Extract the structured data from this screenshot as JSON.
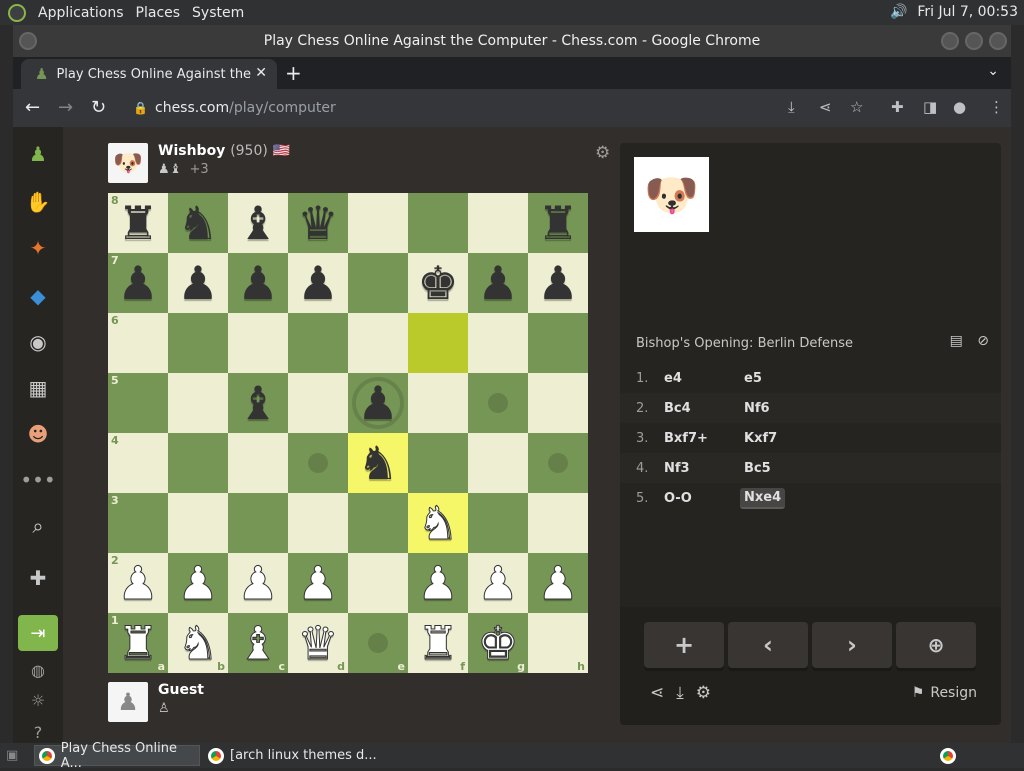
{
  "os": {
    "menu": [
      "Applications",
      "Places",
      "System"
    ],
    "clock": "Fri Jul  7, 00:53"
  },
  "window": {
    "title": "Play Chess Online Against the Computer - Chess.com - Google Chrome"
  },
  "browser": {
    "tab_title": "Play Chess Online Against the",
    "url_host": "chess.com",
    "url_path": "/play/computer"
  },
  "top_player": {
    "name": "Wishboy",
    "rating": "(950)",
    "flag": "🇺🇸",
    "advantage": "+3",
    "captured": "♟♝"
  },
  "bottom_player": {
    "name": "Guest",
    "captured": "♙"
  },
  "board": {
    "ranks": [
      "8",
      "7",
      "6",
      "5",
      "4",
      "3",
      "2",
      "1"
    ],
    "files": [
      "a",
      "b",
      "c",
      "d",
      "e",
      "f",
      "g",
      "h"
    ],
    "position": [
      [
        "bR",
        "bN",
        "bB",
        "bQ",
        "",
        "",
        "",
        "bR"
      ],
      [
        "bP",
        "bP",
        "bP",
        "bP",
        "",
        "bK",
        "bP",
        "bP"
      ],
      [
        "",
        "",
        "",
        "",
        "",
        "",
        "",
        ""
      ],
      [
        "",
        "",
        "bB",
        "",
        "bP",
        "",
        "",
        ""
      ],
      [
        "",
        "",
        "",
        "",
        "bN",
        "",
        "",
        ""
      ],
      [
        "",
        "",
        "",
        "",
        "",
        "wN",
        "",
        ""
      ],
      [
        "wP",
        "wP",
        "wP",
        "wP",
        "",
        "wP",
        "wP",
        "wP"
      ],
      [
        "wR",
        "wN",
        "wB",
        "wQ",
        "",
        "wR",
        "wK",
        ""
      ]
    ],
    "highlights": [
      "f6",
      "e4",
      "f3"
    ],
    "hint_dots": [
      "g5",
      "d4",
      "h4",
      "e1"
    ],
    "hint_rings": [
      "e5"
    ]
  },
  "panel": {
    "opening": "Bishop's Opening: Berlin Defense",
    "moves": [
      {
        "num": "1.",
        "white": "e4",
        "black": "e5"
      },
      {
        "num": "2.",
        "white": "Bc4",
        "black": "Nf6"
      },
      {
        "num": "3.",
        "white": "Bxf7+",
        "black": "Kxf7"
      },
      {
        "num": "4.",
        "white": "Nf3",
        "black": "Bc5"
      },
      {
        "num": "5.",
        "white": "O-O",
        "black": "Nxe4"
      }
    ],
    "resign_label": "Resign"
  },
  "taskbar": {
    "items": [
      "Play Chess Online A...",
      "[arch linux themes d..."
    ]
  },
  "colors": {
    "light_square": "#eeeed2",
    "dark_square": "#769656",
    "accent_green": "#81b64c"
  }
}
